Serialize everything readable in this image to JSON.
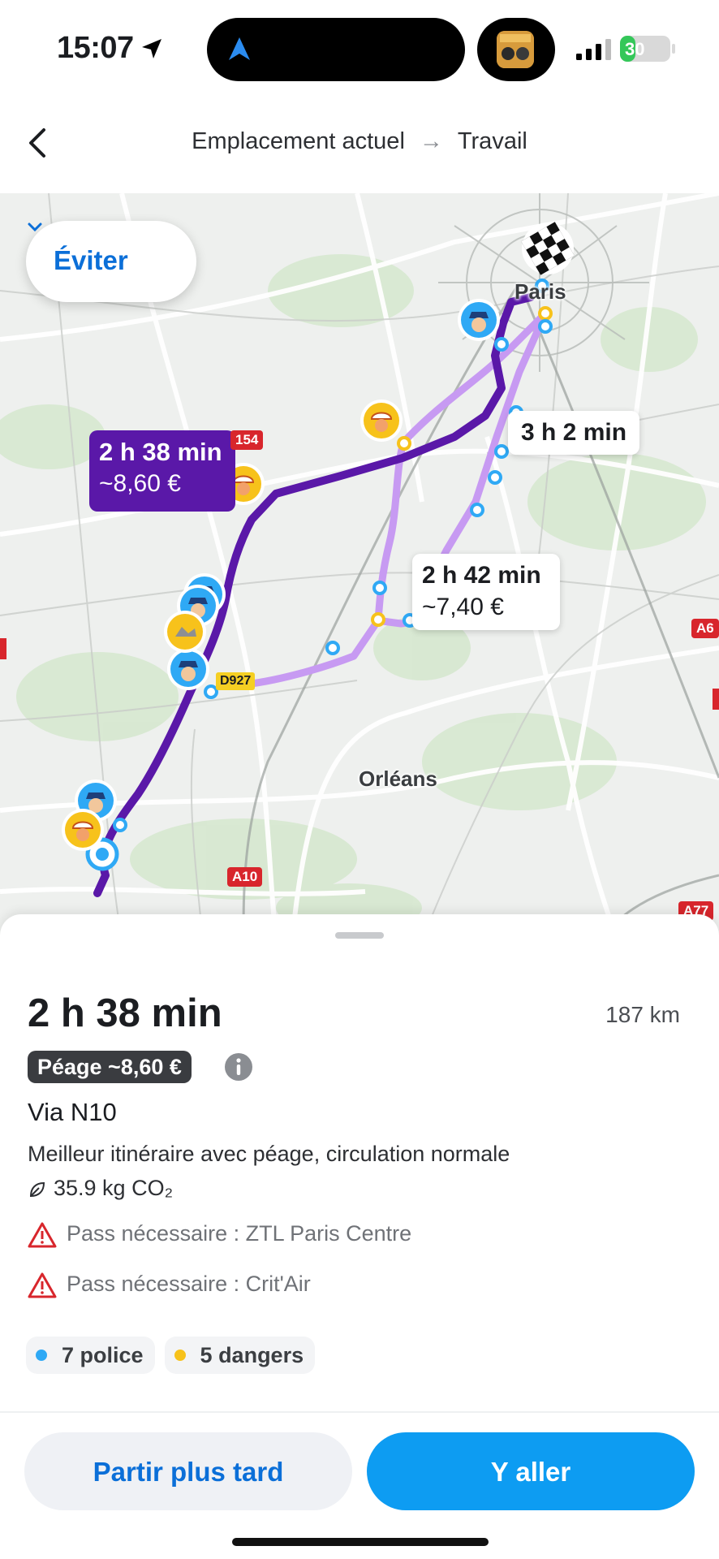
{
  "status": {
    "time": "15:07",
    "battery": "30",
    "battery_level": 0.3
  },
  "header": {
    "origin": "Emplacement actuel",
    "destination": "Travail"
  },
  "map": {
    "avoid_label": "Éviter",
    "selected_route": {
      "duration": "2 h 38 min",
      "cost": "~8,60 €"
    },
    "alt_route_1": {
      "duration": "3 h 2 min"
    },
    "alt_route_2": {
      "duration": "2 h 42 min",
      "cost": "~7,40 €"
    },
    "cities": {
      "paris": "Paris",
      "orleans": "Orléans"
    },
    "roads": {
      "r154": "154",
      "a6": "A6",
      "a10": "A10",
      "a77": "A77",
      "d927": "D927"
    }
  },
  "summary": {
    "duration": "2 h 38 min",
    "distance": "187 km",
    "toll": "Péage ~8,60 €",
    "via": "Via N10",
    "description": "Meilleur itinéraire avec péage, circulation normale",
    "co2": "35.9 kg CO₂",
    "warnings": [
      "Pass nécessaire : ZTL Paris Centre",
      "Pass nécessaire : Crit'Air"
    ],
    "chips": {
      "police": "7 police",
      "dangers": "5 dangers"
    }
  },
  "actions": {
    "later": "Partir plus tard",
    "go": "Y aller"
  },
  "colors": {
    "accent": "#0d9cf2",
    "route_selected": "#5a18a8",
    "route_alt": "#c79af2",
    "police_dot": "#2fa9f5",
    "danger_dot": "#f7c21b"
  }
}
